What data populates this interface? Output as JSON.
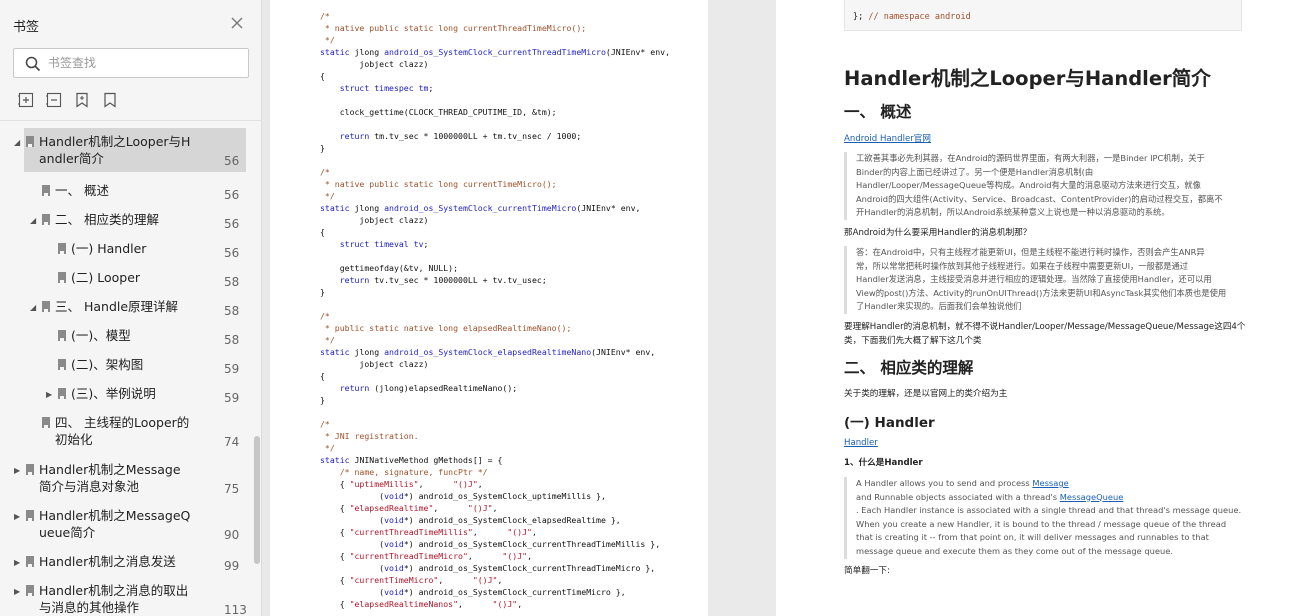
{
  "sidebar": {
    "title": "书签",
    "close_icon": "close-icon",
    "search_placeholder": "书签查找",
    "tool_icons": [
      "expand-all-icon",
      "collapse-all-icon",
      "bookmark-add-icon",
      "bookmark-icon"
    ],
    "items": [
      {
        "lines": [
          "Handler机制之Looper与H",
          "andler简介"
        ],
        "page": "56",
        "level": 0,
        "arrow": "down",
        "selected": true
      },
      {
        "lines": [
          "一、 概述"
        ],
        "page": "56",
        "level": 1,
        "arrow": ""
      },
      {
        "lines": [
          "二、 相应类的理解"
        ],
        "page": "56",
        "level": 1,
        "arrow": "down"
      },
      {
        "lines": [
          "(一) Handler"
        ],
        "page": "56",
        "level": 2,
        "arrow": ""
      },
      {
        "lines": [
          "(二) Looper"
        ],
        "page": "58",
        "level": 2,
        "arrow": ""
      },
      {
        "lines": [
          "三、 Handle原理详解"
        ],
        "page": "58",
        "level": 1,
        "arrow": "down"
      },
      {
        "lines": [
          "(一)、模型"
        ],
        "page": "58",
        "level": 2,
        "arrow": ""
      },
      {
        "lines": [
          "(二)、架构图"
        ],
        "page": "59",
        "level": 2,
        "arrow": ""
      },
      {
        "lines": [
          "(三)、举例说明"
        ],
        "page": "59",
        "level": 2,
        "arrow": "right"
      },
      {
        "lines": [
          "四、 主线程的Looper的",
          "初始化"
        ],
        "page": "74",
        "level": 1,
        "arrow": ""
      },
      {
        "lines": [
          "Handler机制之Message",
          "简介与消息对象池"
        ],
        "page": "75",
        "level": 0,
        "arrow": "right"
      },
      {
        "lines": [
          "Handler机制之MessageQ",
          "ueue简介"
        ],
        "page": "90",
        "level": 0,
        "arrow": "right"
      },
      {
        "lines": [
          "Handler机制之消息发送"
        ],
        "page": "99",
        "level": 0,
        "arrow": "right"
      },
      {
        "lines": [
          "Handler机制之消息的取出",
          "与消息的其他操作"
        ],
        "page": "113",
        "level": 0,
        "arrow": "right"
      }
    ]
  },
  "page1": {
    "code_lines": [
      [
        [
          "c-cm",
          "/*"
        ]
      ],
      [
        [
          "c-cm",
          " * native public static long currentThreadTimeMicro();"
        ]
      ],
      [
        [
          "c-cm",
          " */"
        ]
      ],
      [
        [
          "c-kw",
          "static "
        ],
        [
          "",
          "jlong "
        ],
        [
          "c-fn",
          "android_os_SystemClock_currentThreadTimeMicro"
        ],
        [
          "",
          "(JNIEnv* env,"
        ]
      ],
      [
        [
          "",
          "        jobject clazz)"
        ]
      ],
      [
        [
          "",
          "{"
        ]
      ],
      [
        [
          "",
          "    "
        ],
        [
          "c-kw",
          "struct timespec "
        ],
        [
          "c-kw",
          "tm"
        ],
        [
          "",
          ";"
        ]
      ],
      [
        [
          "",
          ""
        ]
      ],
      [
        [
          "",
          "    clock_gettime(CLOCK_THREAD_CPUTIME_ID, &tm);"
        ]
      ],
      [
        [
          "",
          ""
        ]
      ],
      [
        [
          "",
          "    "
        ],
        [
          "c-kw",
          "return "
        ],
        [
          "",
          "tm.tv_sec * 1000000LL + tm.tv_nsec / 1000;"
        ]
      ],
      [
        [
          "",
          "}"
        ]
      ],
      [
        [
          "",
          ""
        ]
      ],
      [
        [
          "c-cm",
          "/*"
        ]
      ],
      [
        [
          "c-cm",
          " * native public static long currentTimeMicro();"
        ]
      ],
      [
        [
          "c-cm",
          " */"
        ]
      ],
      [
        [
          "c-kw",
          "static "
        ],
        [
          "",
          "jlong "
        ],
        [
          "c-fn",
          "android_os_SystemClock_currentTimeMicro"
        ],
        [
          "",
          "(JNIEnv* env,"
        ]
      ],
      [
        [
          "",
          "        jobject clazz)"
        ]
      ],
      [
        [
          "",
          "{"
        ]
      ],
      [
        [
          "",
          "    "
        ],
        [
          "c-kw",
          "struct timeval "
        ],
        [
          "c-kw",
          "tv"
        ],
        [
          "",
          ";"
        ]
      ],
      [
        [
          "",
          ""
        ]
      ],
      [
        [
          "",
          "    gettimeofday(&tv, NULL);"
        ]
      ],
      [
        [
          "",
          "    "
        ],
        [
          "c-kw",
          "return "
        ],
        [
          "",
          "tv.tv_sec * 1000000LL + tv.tv_usec;"
        ]
      ],
      [
        [
          "",
          "}"
        ]
      ],
      [
        [
          "",
          ""
        ]
      ],
      [
        [
          "c-cm",
          "/*"
        ]
      ],
      [
        [
          "c-cm",
          " * public static native long elapsedRealtimeNano();"
        ]
      ],
      [
        [
          "c-cm",
          " */"
        ]
      ],
      [
        [
          "c-kw",
          "static "
        ],
        [
          "",
          "jlong "
        ],
        [
          "c-fn",
          "android_os_SystemClock_elapsedRealtimeNano"
        ],
        [
          "",
          "(JNIEnv* env,"
        ]
      ],
      [
        [
          "",
          "        jobject clazz)"
        ]
      ],
      [
        [
          "",
          "{"
        ]
      ],
      [
        [
          "",
          "    "
        ],
        [
          "c-kw",
          "return "
        ],
        [
          "",
          "(jlong)elapsedRealtimeNano();"
        ]
      ],
      [
        [
          "",
          "}"
        ]
      ],
      [
        [
          "",
          ""
        ]
      ],
      [
        [
          "c-cm",
          "/*"
        ]
      ],
      [
        [
          "c-cm",
          " * JNI registration."
        ]
      ],
      [
        [
          "c-cm",
          " */"
        ]
      ],
      [
        [
          "c-kw",
          "static "
        ],
        [
          "",
          "JNINativeMethod gMethods[] = {"
        ]
      ],
      [
        [
          "",
          "    "
        ],
        [
          "c-cm",
          "/* name, signature, funcPtr */"
        ]
      ],
      [
        [
          "",
          "    { "
        ],
        [
          "c-str",
          "\"uptimeMillis\""
        ],
        [
          "",
          ",      "
        ],
        [
          "c-str",
          "\"()J\""
        ],
        [
          "",
          ","
        ]
      ],
      [
        [
          "",
          "            ("
        ],
        [
          "c-kw",
          "void"
        ],
        [
          "",
          "*) android_os_SystemClock_uptimeMillis },"
        ]
      ],
      [
        [
          "",
          "    { "
        ],
        [
          "c-str",
          "\"elapsedRealtime\""
        ],
        [
          "",
          ",      "
        ],
        [
          "c-str",
          "\"()J\""
        ],
        [
          "",
          ","
        ]
      ],
      [
        [
          "",
          "            ("
        ],
        [
          "c-kw",
          "void"
        ],
        [
          "",
          "*) android_os_SystemClock_elapsedRealtime },"
        ]
      ],
      [
        [
          "",
          "    { "
        ],
        [
          "c-str",
          "\"currentThreadTimeMillis\""
        ],
        [
          "",
          ",      "
        ],
        [
          "c-str",
          "\"()J\""
        ],
        [
          "",
          ","
        ]
      ],
      [
        [
          "",
          "            ("
        ],
        [
          "c-kw",
          "void"
        ],
        [
          "",
          "*) android_os_SystemClock_currentThreadTimeMillis },"
        ]
      ],
      [
        [
          "",
          "    { "
        ],
        [
          "c-str",
          "\"currentThreadTimeMicro\""
        ],
        [
          "",
          ",      "
        ],
        [
          "c-str",
          "\"()J\""
        ],
        [
          "",
          ","
        ]
      ],
      [
        [
          "",
          "            ("
        ],
        [
          "c-kw",
          "void"
        ],
        [
          "",
          "*) android_os_SystemClock_currentThreadTimeMicro },"
        ]
      ],
      [
        [
          "",
          "    { "
        ],
        [
          "c-str",
          "\"currentTimeMicro\""
        ],
        [
          "",
          ",      "
        ],
        [
          "c-str",
          "\"()J\""
        ],
        [
          "",
          ","
        ]
      ],
      [
        [
          "",
          "            ("
        ],
        [
          "c-kw",
          "void"
        ],
        [
          "",
          "*) android_os_SystemClock_currentTimeMicro },"
        ]
      ],
      [
        [
          "",
          "    { "
        ],
        [
          "c-str",
          "\"elapsedRealtimeNanos\""
        ],
        [
          "",
          ",      "
        ],
        [
          "c-str",
          "\"()J\""
        ],
        [
          "",
          ","
        ]
      ]
    ]
  },
  "page2": {
    "top_code_pre": "}; ",
    "top_code_comment": "// namespace android",
    "title": "Handler机制之Looper与Handler简介",
    "h2_overview": "一、 概述",
    "link_official": "Android Handler官网",
    "quote1": [
      "工欲善其事必先利其器，在Android的源码世界里面，有两大利器，一是Binder IPC机制，关于",
      "Binder的内容上面已经讲过了。另一个便是Handler消息机制(由",
      "Handler/Looper/MessageQueue等构成。Android有大量的消息驱动方法来进行交互，就像",
      "Android的四大组件(Activity、Service、Broadcast、ContentProvider)的启动过程交互，都离不",
      "开Handler的消息机制，所以Android系统某种意义上说也是一种以消息驱动的系统。"
    ],
    "question": "那Android为什么要采用Handler的消息机制那？",
    "quote2": [
      "答：在Android中，只有主线程才能更新UI，但是主线程不能进行耗时操作，否则会产生ANR异",
      "常，所以常常把耗时操作放到其他子线程进行。如果在子线程中需要更新UI，一般都是通过",
      "Handler发送消息，主线接受消息并进行相应的逻辑处理。当然除了直接使用Handler，还可以用",
      "View的post()方法、Activity的runOnUIThread()方法来更新UI和AsyncTask其实他们本质也是使用",
      "了Handler来实现的。后面我们会单独说他们"
    ],
    "summary": [
      "要理解Handler的消息机制，就不得不说Handler/Looper/Message/MessageQueue/Message这四4个",
      "类，下面我们先大概了解下这几个类"
    ],
    "h2_classes": "二、 相应类的理解",
    "classes_intro": "关于类的理解，还是以官网上的类介绍为主",
    "h3_handler": "(一) Handler",
    "link_handler": "Handler",
    "what_is": "1、什么是Handler",
    "quote3_l1_pre": "A Handler allows you to send and process ",
    "quote3_l1_link": "Message",
    "quote3_l2_pre": "and Runnable objects associated with a thread's ",
    "quote3_l2_link": "MessageQueue",
    "quote3_rest": [
      ". Each Handler instance is associated with a single thread and that thread's message queue.",
      "When you create a new Handler, it is bound to the thread / message queue of the thread",
      "that is creating it -- from that point on, it will deliver messages and runnables to that",
      "message queue and execute them as they come out of the message queue."
    ],
    "translate": "简单翻一下:"
  }
}
